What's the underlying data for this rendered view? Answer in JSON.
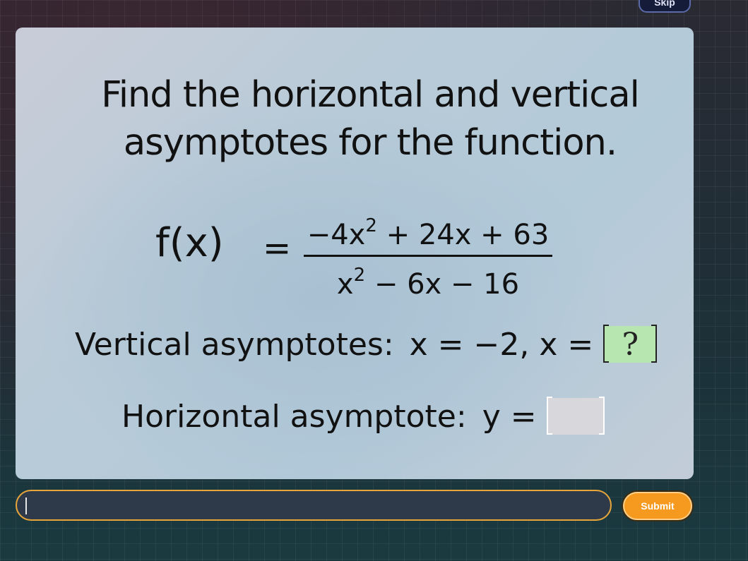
{
  "header": {
    "skip_label": "Skip"
  },
  "question": {
    "line1": "Find the horizontal and vertical",
    "line2": "asymptotes for the function."
  },
  "function": {
    "lhs": "f(x)",
    "equals": "=",
    "numerator": {
      "a": "−4x",
      "exp": "2",
      "b": " + 24x + 63"
    },
    "denominator": {
      "a": "x",
      "exp": "2",
      "b": " − 6x − 16"
    }
  },
  "vertical": {
    "label": "Vertical asymptotes:",
    "expr": "x = −2,  x =",
    "box_value": "?"
  },
  "horizontal": {
    "label": "Horizontal asymptote:",
    "expr": "y =",
    "box_value": ""
  },
  "answer_input": {
    "value": ""
  },
  "submit_label": "Submit",
  "colors": {
    "accent": "#f59a1f",
    "input_border": "#e8a63a",
    "green_box": "#b8e6b0",
    "gray_box": "#d8d8dc"
  }
}
